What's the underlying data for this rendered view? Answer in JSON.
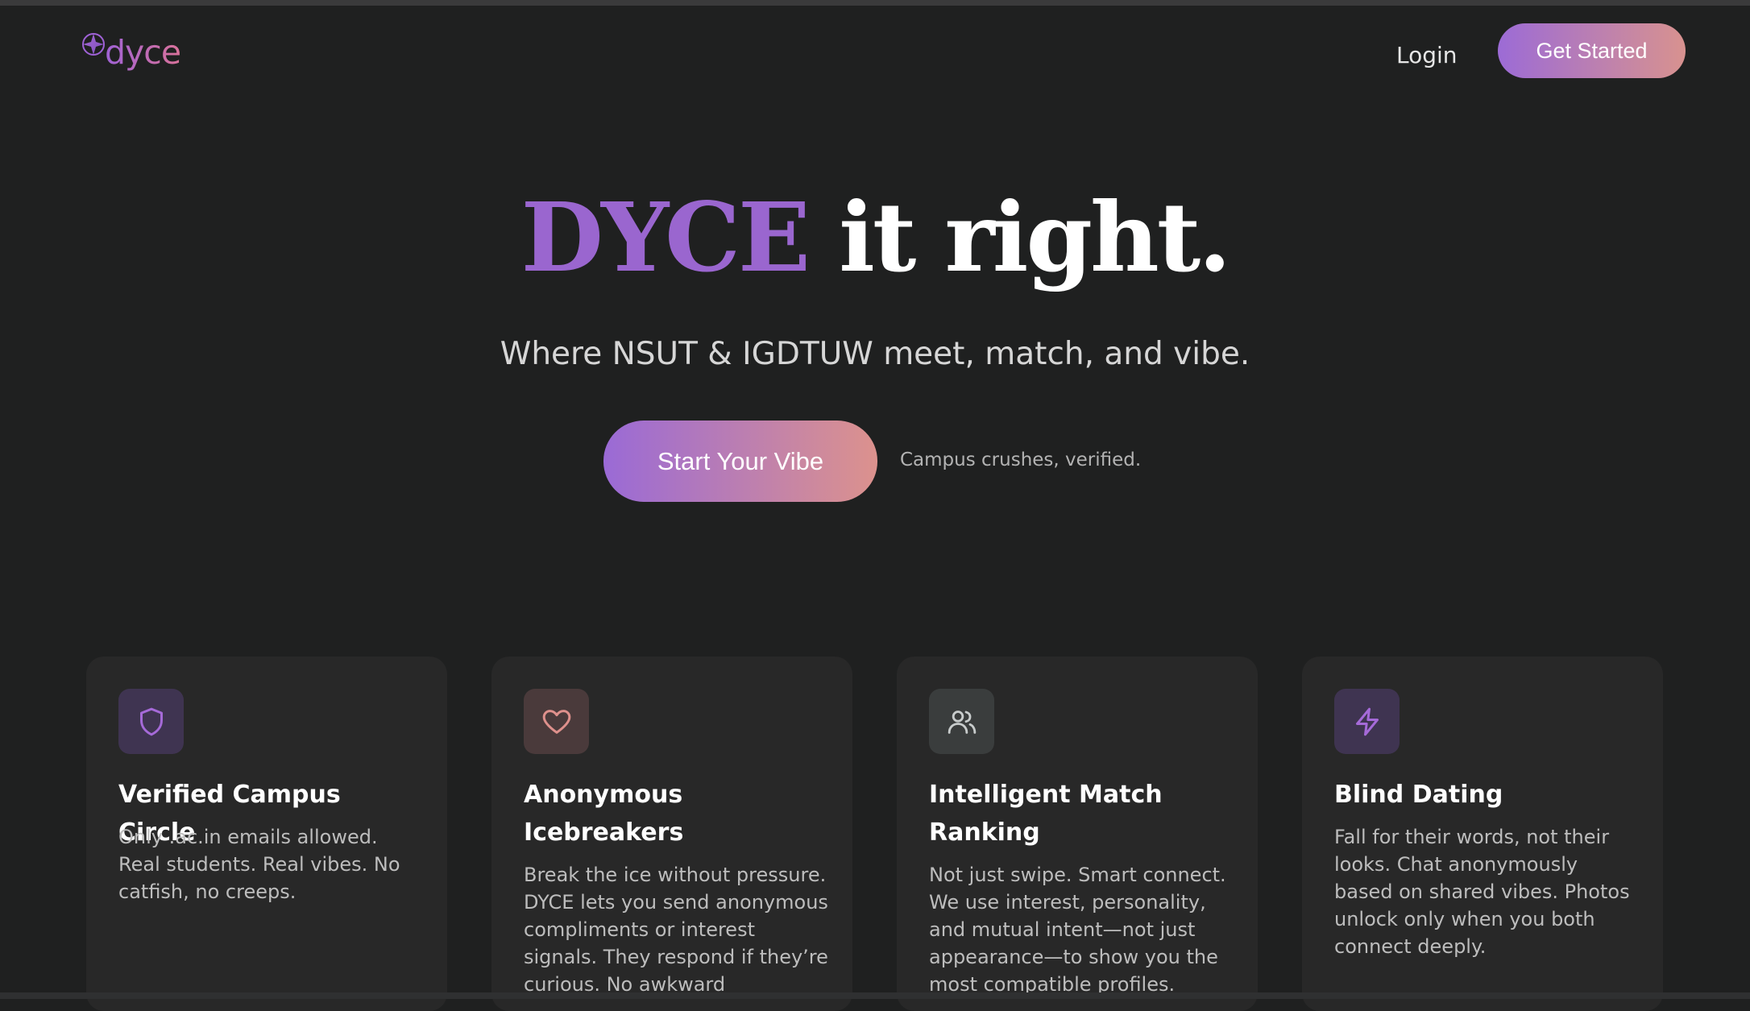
{
  "brand": {
    "logo_text": "dyce",
    "gradient_start": "#9f62d6",
    "gradient_end": "#d9729a"
  },
  "nav": {
    "login_label": "Login",
    "get_started_label": "Get Started"
  },
  "hero": {
    "title_accent": "DYCE",
    "title_rest": "it right.",
    "subtitle": "Where NSUT & IGDTUW meet, match, and vibe.",
    "cta_label": "Start Your Vibe",
    "cta_note": "Campus crushes, verified."
  },
  "features": [
    {
      "icon": "shield-icon",
      "title": "Verified Campus Circle",
      "text": "Only .ac.in emails allowed. Real students. Real vibes. No catfish, no creeps."
    },
    {
      "icon": "heart-icon",
      "title": "Anonymous Icebreakers",
      "text": "Break the ice without pressure. DYCE lets you send anonymous compliments or interest signals. They respond if they’re curious. No awkward"
    },
    {
      "icon": "users-icon",
      "title": "Intelligent Match Ranking",
      "text": "Not just swipe. Smart connect. We use interest, personality, and mutual intent—not just appearance—to show you the most compatible profiles."
    },
    {
      "icon": "lightning-icon",
      "title": "Blind Dating",
      "text": "Fall for their words, not their looks. Chat anonymously based on shared vibes. Photos unlock only when you both connect deeply."
    }
  ],
  "colors": {
    "background": "#1f2020",
    "card_background": "#282828",
    "accent_purple": "#9a66cf",
    "accent_pink": "#d8928f"
  }
}
